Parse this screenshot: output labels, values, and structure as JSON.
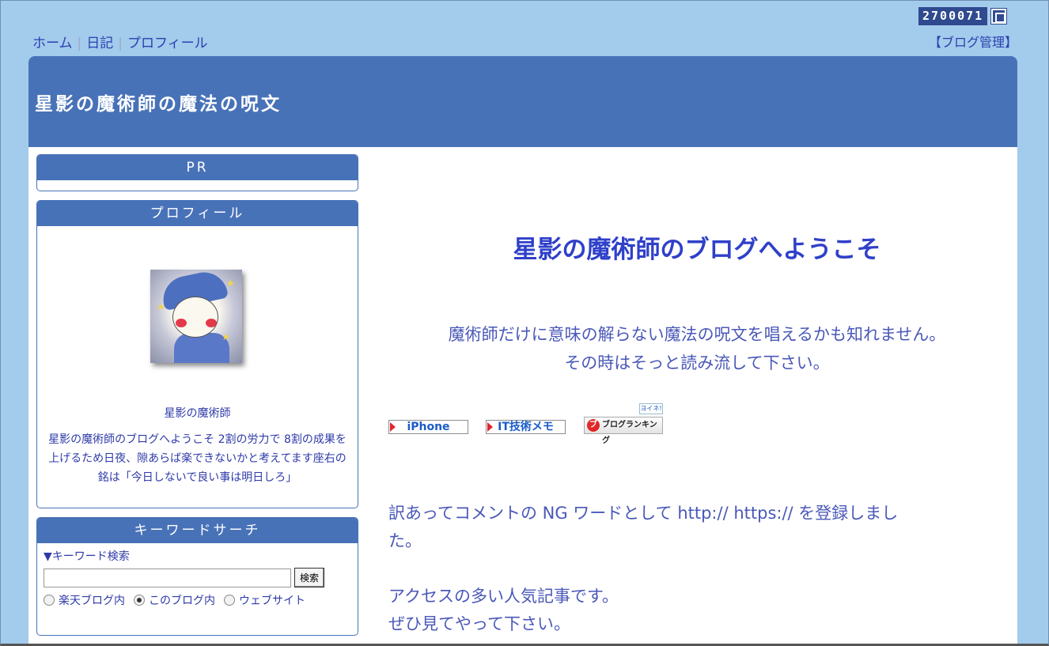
{
  "counter": {
    "value": "2700071",
    "icon": "counter-widget-icon"
  },
  "topnav": {
    "items": [
      {
        "label": "ホーム"
      },
      {
        "label": "日記"
      },
      {
        "label": "プロフィール"
      }
    ],
    "admin_label": "【ブログ管理】"
  },
  "header": {
    "title": "星影の魔術師の魔法の呪文"
  },
  "sidebar": {
    "pr": {
      "title": "PR"
    },
    "profile": {
      "title": "プロフィール",
      "name": "星影の魔術師",
      "description": "星影の魔術師のブログへようこそ 2割の労力で 8割の成果を上げるため日夜、隙あらば楽できないかと考えてます座右の銘は「今日しないで良い事は明日しろ」"
    },
    "search": {
      "title": "キーワードサーチ",
      "label": "▼キーワード検索",
      "input_value": "",
      "button_label": "検索",
      "options": [
        {
          "label": "楽天ブログ内",
          "checked": false
        },
        {
          "label": "このブログ内",
          "checked": true
        },
        {
          "label": "ウェブサイト",
          "checked": false
        }
      ]
    }
  },
  "main": {
    "welcome": "星影の魔術師のブログへようこそ",
    "lead_line1": "魔術師だけに意味の解らない魔法の呪文を唱えるかも知れません。",
    "lead_line2": "その時はそっと読み流して下さい。",
    "badges": {
      "iphone": "iPhone",
      "it_memo": "IT技術メモ",
      "ranking": "ブログランキング",
      "ranking_logo": "ブ",
      "ranking_tag": "ヨイネ!"
    },
    "notice_line1": "訳あってコメントの NG ワードとして http:// https:// を登録しまし",
    "notice_line2": "た。",
    "popular_line1": "アクセスの多い人気記事です。",
    "popular_line2": "ぜひ見てやって下さい。"
  }
}
